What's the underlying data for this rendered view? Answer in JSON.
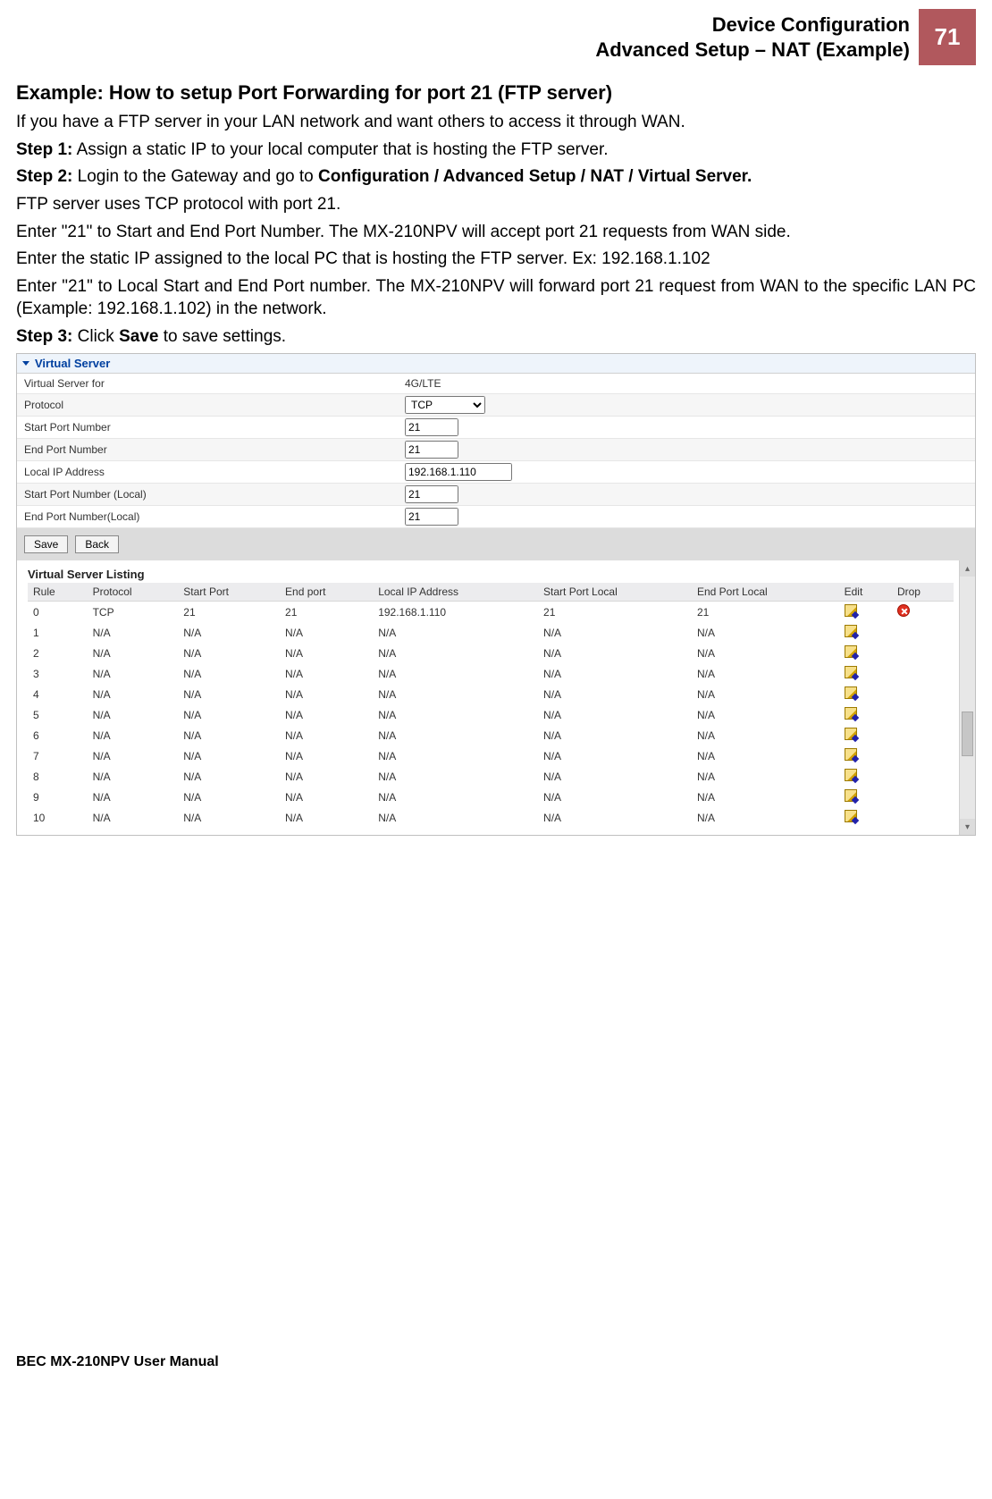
{
  "header": {
    "title_line1": "Device Configuration",
    "title_line2": "Advanced Setup – NAT (Example)",
    "page_number": "71"
  },
  "content": {
    "heading": "Example: How to setup Port Forwarding for port 21 (FTP server)",
    "p1": "If you have a FTP server in your LAN network and want others to access it through WAN.",
    "step1_label": "Step 1:",
    "step1_text": "  Assign a static IP to your local computer that is hosting the FTP server.",
    "step2_label": "Step 2:",
    "step2_text_a": "  Login to the Gateway and go to ",
    "step2_nav": "Configuration / Advanced Setup / NAT / Virtual Server.",
    "p4": "FTP server uses TCP protocol with port 21.",
    "p5": "Enter \"21\" to Start and End Port Number.  The MX-210NPV will accept port 21 requests from WAN side.",
    "p6": "Enter the static IP assigned to the local PC that is hosting the FTP server. Ex: 192.168.1.102",
    "p7": "Enter \"21\" to Local Start and End Port number. The MX-210NPV will forward port 21 request from WAN to the specific LAN PC (Example: 192.168.1.102) in the network.",
    "step3_label": "Step 3:",
    "step3_text_a": " Click ",
    "step3_bold": "Save",
    "step3_text_b": " to save settings."
  },
  "vs_panel": {
    "title": "Virtual Server",
    "rows": {
      "r1_label": "Virtual Server for",
      "r1_value": "4G/LTE",
      "r2_label": "Protocol",
      "r2_value": "TCP",
      "r3_label": "Start Port Number",
      "r3_value": "21",
      "r4_label": "End Port Number",
      "r4_value": "21",
      "r5_label": "Local IP Address",
      "r5_value": "192.168.1.110",
      "r6_label": "Start Port Number (Local)",
      "r6_value": "21",
      "r7_label": "End Port Number(Local)",
      "r7_value": "21"
    },
    "buttons": {
      "save": "Save",
      "back": "Back"
    }
  },
  "listing": {
    "title": "Virtual Server Listing",
    "headers": {
      "rule": "Rule",
      "protocol": "Protocol",
      "start": "Start Port",
      "end": "End port",
      "ip": "Local IP Address",
      "startl": "Start Port Local",
      "endl": "End Port Local",
      "edit": "Edit",
      "drop": "Drop"
    },
    "rows": [
      {
        "rule": "0",
        "protocol": "TCP",
        "start": "21",
        "end": "21",
        "ip": "192.168.1.110",
        "startl": "21",
        "endl": "21",
        "drop": true
      },
      {
        "rule": "1",
        "protocol": "N/A",
        "start": "N/A",
        "end": "N/A",
        "ip": "N/A",
        "startl": "N/A",
        "endl": "N/A",
        "drop": false
      },
      {
        "rule": "2",
        "protocol": "N/A",
        "start": "N/A",
        "end": "N/A",
        "ip": "N/A",
        "startl": "N/A",
        "endl": "N/A",
        "drop": false
      },
      {
        "rule": "3",
        "protocol": "N/A",
        "start": "N/A",
        "end": "N/A",
        "ip": "N/A",
        "startl": "N/A",
        "endl": "N/A",
        "drop": false
      },
      {
        "rule": "4",
        "protocol": "N/A",
        "start": "N/A",
        "end": "N/A",
        "ip": "N/A",
        "startl": "N/A",
        "endl": "N/A",
        "drop": false
      },
      {
        "rule": "5",
        "protocol": "N/A",
        "start": "N/A",
        "end": "N/A",
        "ip": "N/A",
        "startl": "N/A",
        "endl": "N/A",
        "drop": false
      },
      {
        "rule": "6",
        "protocol": "N/A",
        "start": "N/A",
        "end": "N/A",
        "ip": "N/A",
        "startl": "N/A",
        "endl": "N/A",
        "drop": false
      },
      {
        "rule": "7",
        "protocol": "N/A",
        "start": "N/A",
        "end": "N/A",
        "ip": "N/A",
        "startl": "N/A",
        "endl": "N/A",
        "drop": false
      },
      {
        "rule": "8",
        "protocol": "N/A",
        "start": "N/A",
        "end": "N/A",
        "ip": "N/A",
        "startl": "N/A",
        "endl": "N/A",
        "drop": false
      },
      {
        "rule": "9",
        "protocol": "N/A",
        "start": "N/A",
        "end": "N/A",
        "ip": "N/A",
        "startl": "N/A",
        "endl": "N/A",
        "drop": false
      },
      {
        "rule": "10",
        "protocol": "N/A",
        "start": "N/A",
        "end": "N/A",
        "ip": "N/A",
        "startl": "N/A",
        "endl": "N/A",
        "drop": false
      }
    ]
  },
  "footer": {
    "text": "BEC MX-210NPV User Manual"
  }
}
